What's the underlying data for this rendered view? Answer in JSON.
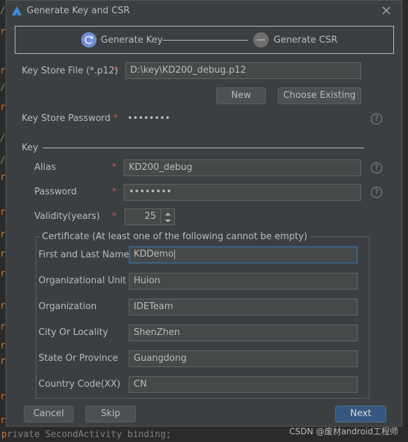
{
  "dialog": {
    "title": "Generate Key and CSR",
    "steps": [
      {
        "label": "Generate Key",
        "state": "active"
      },
      {
        "label": "Generate CSR",
        "state": "pending"
      }
    ]
  },
  "keystore": {
    "file_label": "Key Store File (*.p12)",
    "file_value": "D:\\key\\KD200_debug.p12",
    "new_button": "New",
    "choose_button": "Choose Existing",
    "password_label": "Key Store Password",
    "password_mask": "••••••••"
  },
  "key": {
    "section_label": "Key",
    "alias_label": "Alias",
    "alias_value": "KD200_debug",
    "password_label": "Password",
    "password_mask": "••••••••",
    "validity_label": "Validity(years)",
    "validity_value": "25"
  },
  "certificate": {
    "legend": "Certificate (At least one of the following cannot be empty)",
    "fields": [
      {
        "label": "First and Last Name",
        "value": "KDDemo"
      },
      {
        "label": "Organizational Unit",
        "value": "Huion"
      },
      {
        "label": "Organization",
        "value": "IDETeam"
      },
      {
        "label": "City Or Locality",
        "value": "ShenZhen"
      },
      {
        "label": "State Or Province",
        "value": "Guangdong"
      },
      {
        "label": "Country Code(XX)",
        "value": "CN"
      }
    ]
  },
  "footer": {
    "cancel": "Cancel",
    "skip": "Skip",
    "next": "Next"
  },
  "required_mark": "*",
  "help_glyph": "?",
  "watermark": "CSDN @废材android工程师",
  "background": {
    "bottom_code": "rivate SecondActivity binding;"
  },
  "colors": {
    "dialog_bg": "#3c3f41",
    "field_bg": "#45494a",
    "primary_button": "#365880",
    "required": "#c75450",
    "step_active": "#6f8fcf"
  },
  "icons": [
    "app-logo-icon",
    "close-icon",
    "step-refresh-icon",
    "step-more-icon",
    "help-icon",
    "spinner-up-icon",
    "spinner-down-icon"
  ]
}
